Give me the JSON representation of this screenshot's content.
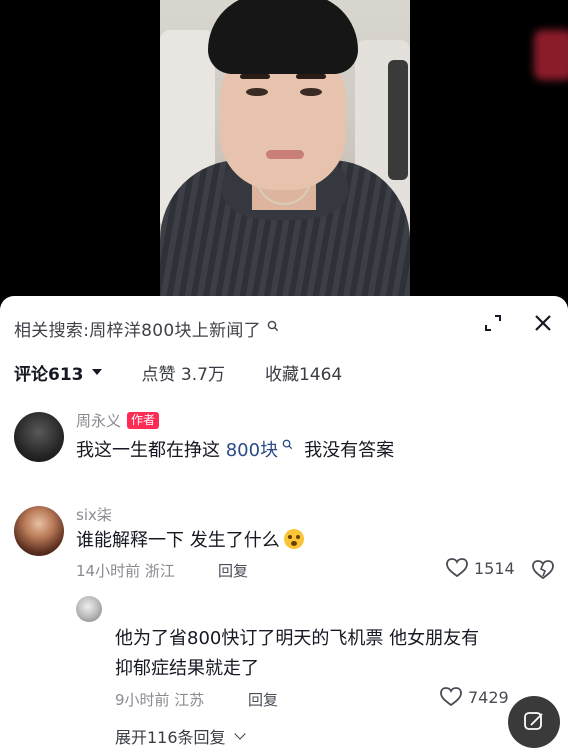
{
  "related_search": {
    "label": "相关搜索:",
    "query": "周梓洋800块上新闻了"
  },
  "stats": {
    "comments_label": "评论613",
    "likes_label": "点赞 3.7万",
    "favorites_label": "收藏1464"
  },
  "comments": [
    {
      "username": "周永义",
      "badge": "作者",
      "text_prefix": "我这一生都在挣这 ",
      "text_link": "800块",
      "text_suffix": "我没有答案"
    },
    {
      "username": "six柒",
      "text": "谁能解释一下 发生了什么",
      "time": "14小时前 浙江",
      "reply_label": "回复",
      "likes": "1514"
    }
  ],
  "reply": {
    "text_line1": "他为了省800快订了明天的飞机票 他女朋友有",
    "text_line2": "抑郁症结果就走了",
    "time": "9小时前 江苏",
    "reply_label": "回复",
    "likes": "7429"
  },
  "expand_replies_label": "展开116条回复",
  "icons": {
    "search": "search-icon",
    "expand": "expand-icon",
    "close": "close-icon",
    "heart": "heart-icon",
    "dislike": "broken-heart-icon",
    "edit": "edit-icon"
  },
  "colors": {
    "author_badge": "#fe2c55",
    "link": "#2a4b84"
  }
}
